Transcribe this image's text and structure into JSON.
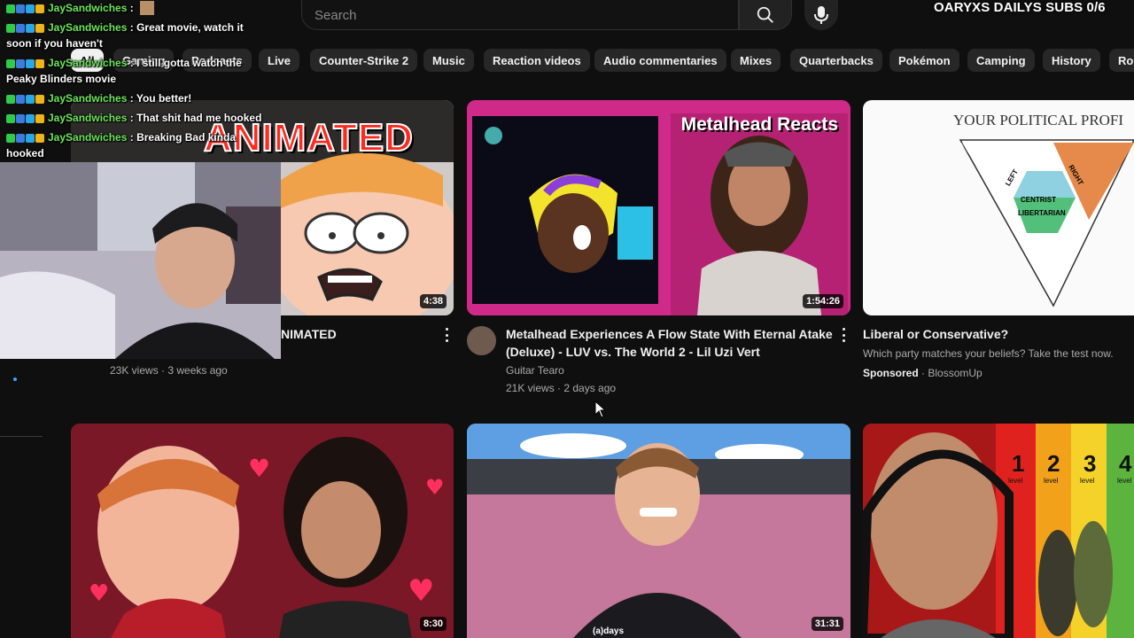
{
  "search": {
    "placeholder": "Search"
  },
  "overlay_counter": "OARYXS DAILYS SUBS 0/6",
  "chips": [
    {
      "label": "All"
    },
    {
      "label": "Gaming"
    },
    {
      "label": "Podcasts"
    },
    {
      "label": "Live"
    },
    {
      "label": "Counter-Strike 2"
    },
    {
      "label": "Music"
    },
    {
      "label": "Reaction videos"
    },
    {
      "label": "Audio commentaries"
    },
    {
      "label": "Mixes"
    },
    {
      "label": "Quarterbacks"
    },
    {
      "label": "Pokémon"
    },
    {
      "label": "Camping"
    },
    {
      "label": "History"
    },
    {
      "label": "Rob"
    }
  ],
  "videos": [
    {
      "thumb_text": "ANIMATED",
      "duration": "4:38",
      "title": "NIMATED",
      "meta": "23K views · 3 weeks ago"
    },
    {
      "thumb_text": "Metalhead Reacts",
      "duration": "1:54:26",
      "title_line1": "Metalhead Experiences A Flow State With Eternal Atake",
      "title_line2": "(Deluxe) - LUV vs. The World 2 - Lil Uzi Vert",
      "channel": "Guitar Tearo",
      "meta": "21K views · 2 days ago"
    },
    {
      "thumb_text": "YOUR POLITICAL PROFI",
      "thumb_labels": [
        "LEFT",
        "RIGHT",
        "CENTRIST",
        "LIBERTARIAN"
      ],
      "title": "Liberal or Conservative?",
      "desc": "Which party matches your beliefs? Take the test now.",
      "sponsored": "Sponsored",
      "advertiser": "· BlossomUp"
    },
    {
      "duration": "8:30"
    },
    {
      "duration": "31:31",
      "shirt_text": "(a)days"
    },
    {
      "levels": [
        "1",
        "2",
        "3",
        "4"
      ],
      "level_word": "level"
    }
  ],
  "chat": [
    {
      "name": "JaySandwiches",
      "text": ":",
      "emote": true
    },
    {
      "name": "JaySandwiches",
      "text": ": Great movie, watch it soon if you haven't"
    },
    {
      "name": "JaySandwiches",
      "text": ": I still gotta watch the Peaky Blinders movie"
    },
    {
      "name": "JaySandwiches",
      "text": ": You better!"
    },
    {
      "name": "JaySandwiches",
      "text": ": That shit had me hooked"
    },
    {
      "name": "JaySandwiches",
      "text": ": Breaking Bad kinda hooked"
    }
  ],
  "colors": {
    "background": "#0f0f0f",
    "chip": "#272727",
    "chat_name": "#6ee65a",
    "meta_text": "#aaaaaa"
  }
}
